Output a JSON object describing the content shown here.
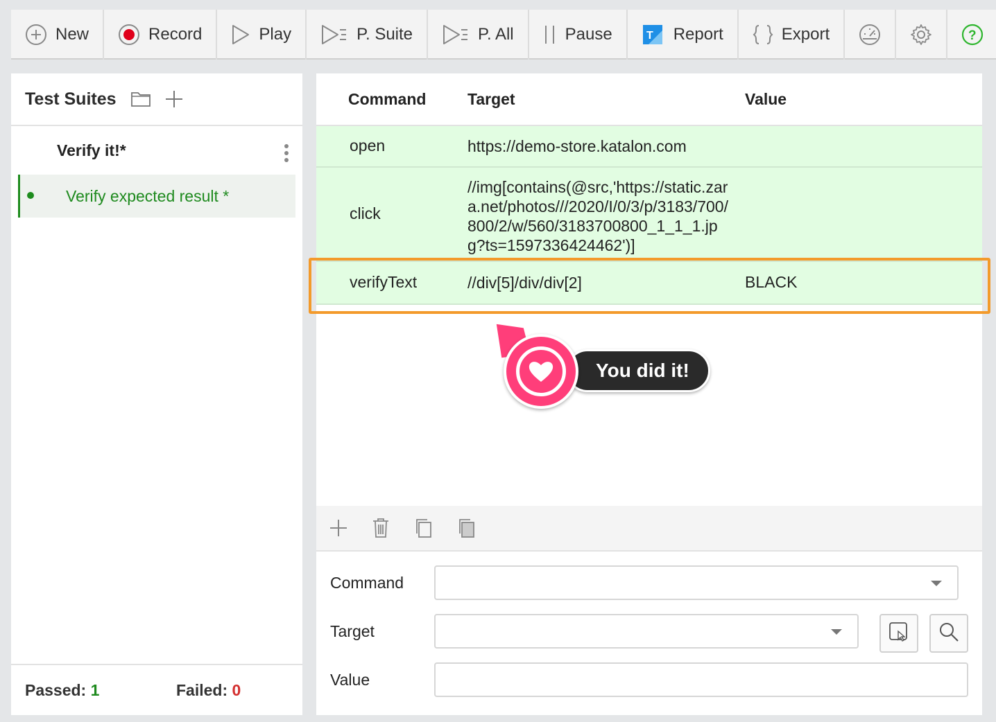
{
  "toolbar": {
    "new": "New",
    "record": "Record",
    "play": "Play",
    "play_suite": "P. Suite",
    "play_all": "P. All",
    "pause": "Pause",
    "report": "Report",
    "export": "Export"
  },
  "sidebar": {
    "title": "Test Suites",
    "suite_name": "Verify it!*",
    "test_case": "Verify expected result *",
    "passed_label": "Passed:",
    "passed_count": "1",
    "failed_label": "Failed:",
    "failed_count": "0"
  },
  "table": {
    "headers": {
      "command": "Command",
      "target": "Target",
      "value": "Value"
    },
    "rows": [
      {
        "command": "open",
        "target": "https://demo-store.katalon.com",
        "value": ""
      },
      {
        "command": "click",
        "target": "//img[contains(@src,'https://static.zara.net/photos///2020/I/0/3/p/3183/700/800/2/w/560/3183700800_1_1_1.jpg?ts=1597336424462')]",
        "value": ""
      },
      {
        "command": "verifyText",
        "target": "//div[5]/div/div[2]",
        "value": "BLACK"
      }
    ]
  },
  "badge": {
    "text": "You did it!"
  },
  "editor": {
    "command_label": "Command",
    "target_label": "Target",
    "value_label": "Value"
  },
  "colors": {
    "row_pass_bg": "#e2fde2",
    "highlight": "#f39a2b",
    "record_red": "#e0001b",
    "pass_green": "#1e8a1e",
    "fail_red": "#d32f2f",
    "badge_pink": "#ff3e7a",
    "help_green": "#2db52d"
  }
}
